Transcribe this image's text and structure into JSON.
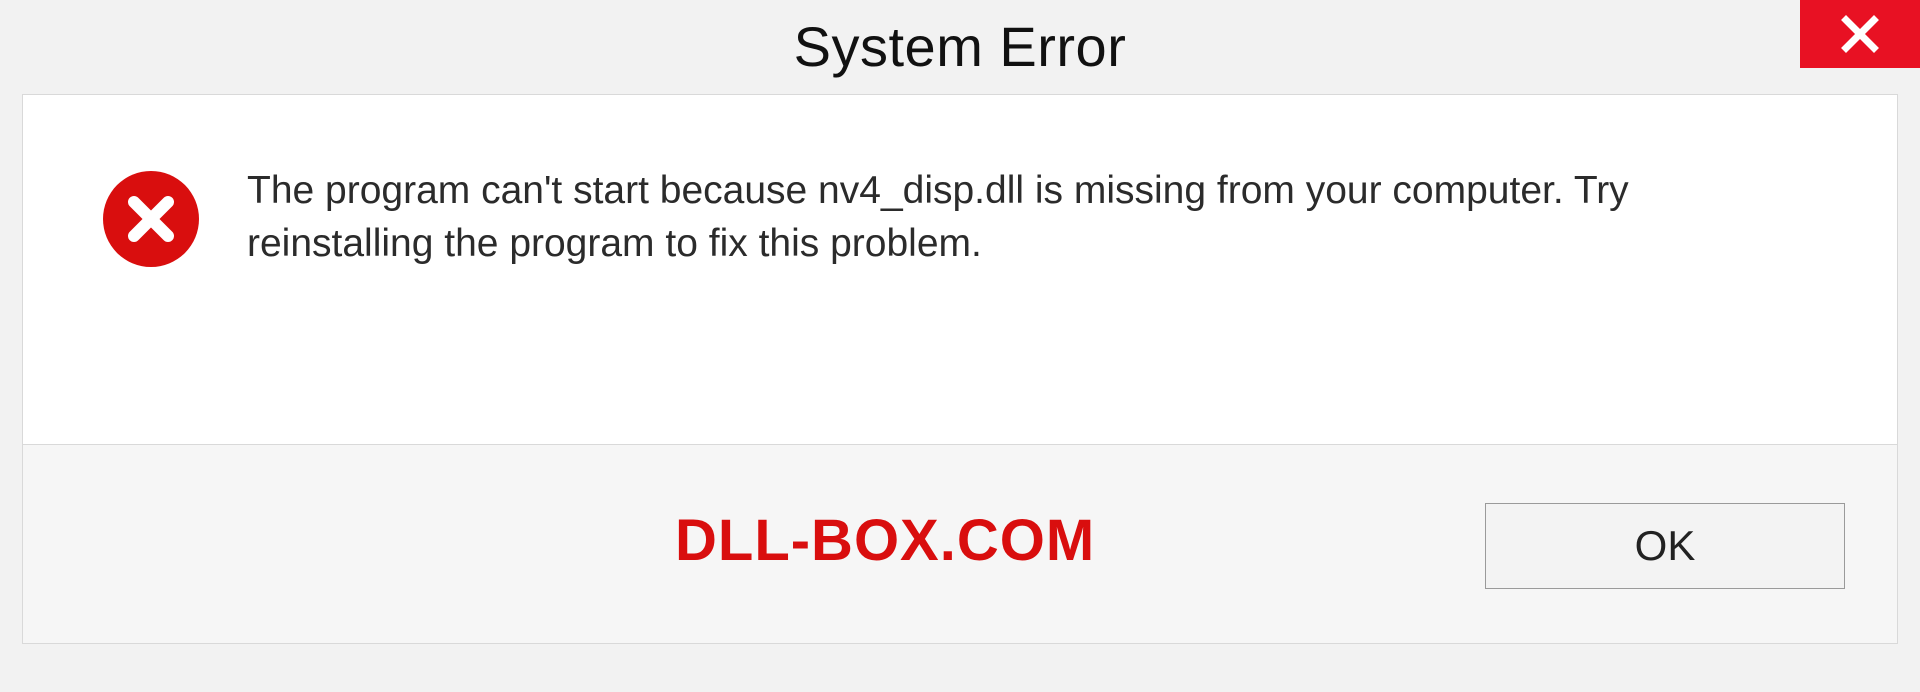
{
  "title": "System Error",
  "message": "The program can't start because nv4_disp.dll is missing from your computer. Try reinstalling the program to fix this problem.",
  "brand": "DLL-BOX.COM",
  "buttons": {
    "ok": "OK"
  },
  "colors": {
    "accent_red": "#d90e0e",
    "close_red": "#e81123"
  }
}
